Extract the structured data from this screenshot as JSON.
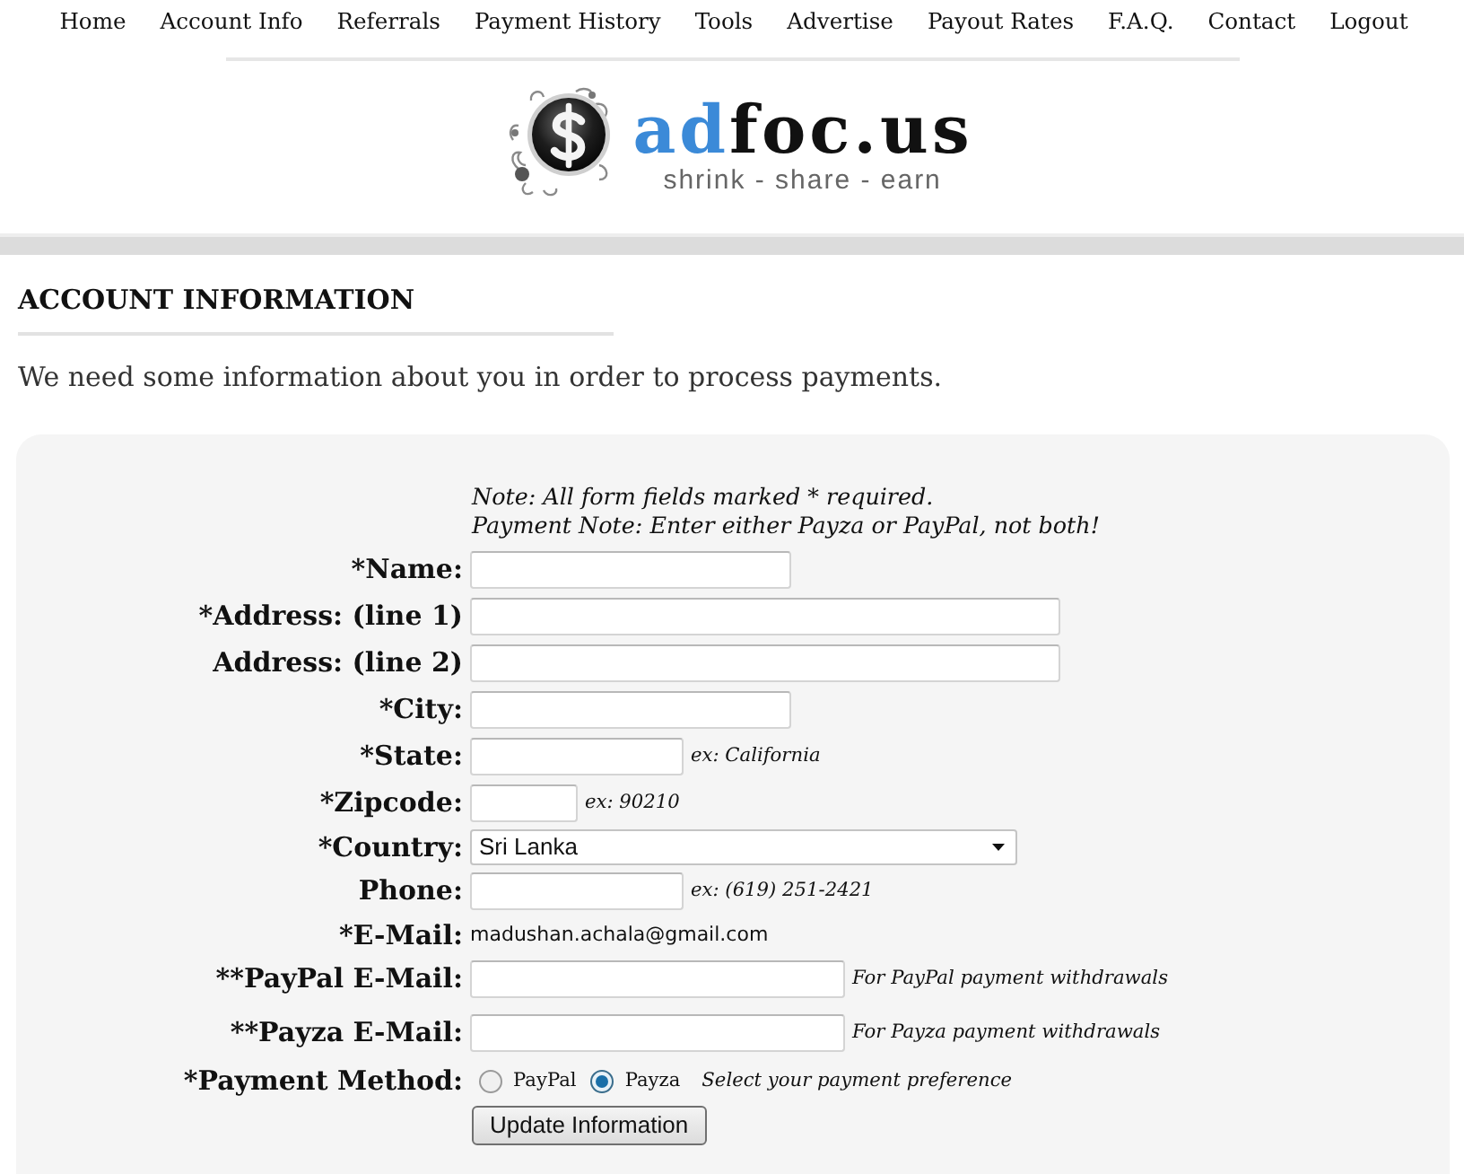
{
  "nav": [
    "Home",
    "Account Info",
    "Referrals",
    "Payment History",
    "Tools",
    "Advertise",
    "Payout Rates",
    "F.A.Q.",
    "Contact",
    "Logout"
  ],
  "logo": {
    "name_highlight": "ad",
    "name_rest": "foc.us",
    "tagline": "shrink - share - earn"
  },
  "heading": "ACCOUNT INFORMATION",
  "intro": "We need some information about you in order to process payments.",
  "form": {
    "notes": [
      "Note: All form fields marked * required.",
      "Payment Note: Enter either Payza or PayPal, not both!"
    ],
    "fields": [
      {
        "kind": "text",
        "label": "*Name:"
      },
      {
        "kind": "text",
        "label": "*Address: (line 1)"
      },
      {
        "kind": "text",
        "label": "Address: (line 2)"
      },
      {
        "kind": "text",
        "label": "*City:"
      },
      {
        "kind": "text",
        "label": "*State:",
        "hint": "ex: California"
      },
      {
        "kind": "text",
        "label": "*Zipcode:",
        "hint": "ex: 90210"
      },
      {
        "kind": "select",
        "label": "*Country:",
        "value": "Sri Lanka"
      },
      {
        "kind": "text",
        "label": "Phone:",
        "hint": "ex: (619) 251-2421"
      },
      {
        "kind": "static",
        "label": "*E-Mail:",
        "value": "madushan.achala@gmail.com"
      },
      {
        "kind": "text",
        "label": "**PayPal E-Mail:",
        "hint": "For PayPal payment withdrawals"
      },
      {
        "kind": "text",
        "label": "**Payza E-Mail:",
        "hint": "For Payza payment withdrawals"
      },
      {
        "kind": "radio",
        "label": "*Payment Method:",
        "options": [
          {
            "label": "PayPal",
            "selected": false
          },
          {
            "label": "Payza",
            "selected": true
          }
        ],
        "hint": "Select your payment preference"
      }
    ],
    "submit": "Update Information"
  }
}
